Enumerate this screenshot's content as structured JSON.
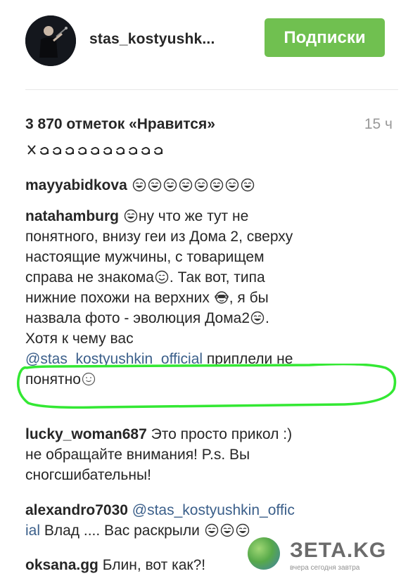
{
  "header": {
    "username": "stas_kostyushk...",
    "follow_label": "Подписки"
  },
  "post": {
    "likes": "3 870 отметок «Нравится»",
    "time": "15 ч"
  },
  "comments": [
    {
      "user": "mayyabidkova",
      "text": ""
    },
    {
      "user": "natahamburg",
      "line1_after_emoji": "ну что же тут не",
      "line2": "понятного, внизу геи из Дома 2, сверху",
      "line3": "настоящие мужчины, с товарищем",
      "line4": "справа не знакома",
      "line4b": ". Так вот, типа",
      "line5": "нижние похожи на верхних",
      "line5b": ", я бы",
      "line6": "назвала фото - эволюция Дома2",
      "line6b": ".",
      "line7": "Хотя к чему вас",
      "mention": "@stas_kostyushkin_official",
      "line8b": "приплели не",
      "line9": "понятно"
    },
    {
      "user": "lucky_woman687",
      "line1": "Это просто прикол :)",
      "line2": "не обращайте внимания! P.s. Вы",
      "line3": "сногсшибательны!"
    },
    {
      "user": "alexandro7030",
      "mention1": "@stas_kostyushkin_offic",
      "mention2": "ial",
      "line2": "Влад .... Вас раскрыли"
    },
    {
      "user": "oksana.gg",
      "text": "Блин, вот как?!"
    }
  ],
  "watermark": {
    "text": "ЗЕТА.KG",
    "sub": "вчера сегодня завтра"
  },
  "colors": {
    "follow_button": "#70c050",
    "mention": "#3b5f8a",
    "highlight": "#33e833",
    "muted": "#999999"
  }
}
